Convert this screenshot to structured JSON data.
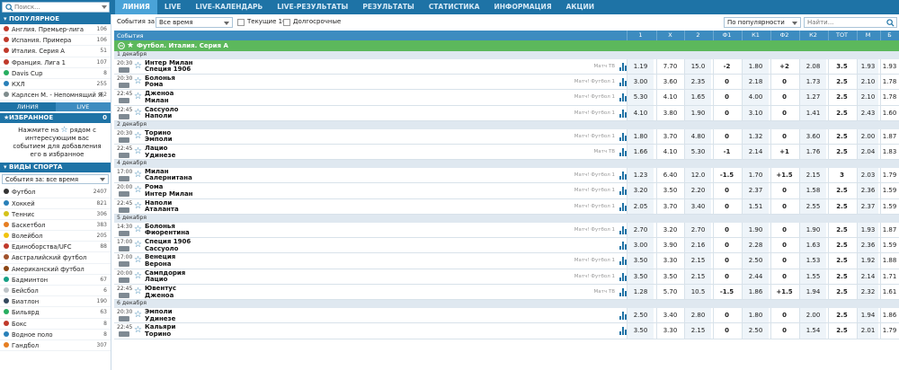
{
  "search": {
    "placeholder": "Поиск..."
  },
  "nav": [
    {
      "label": "ЛИНИЯ",
      "active": true
    },
    {
      "label": "LIVE",
      "active": false
    },
    {
      "label": "LIVE-КАЛЕНДАРЬ",
      "active": false
    },
    {
      "label": "LIVE-РЕЗУЛЬТАТЫ",
      "active": false
    },
    {
      "label": "РЕЗУЛЬТАТЫ",
      "active": false
    },
    {
      "label": "СТАТИСТИКА",
      "active": false
    },
    {
      "label": "ИНФОРМАЦИЯ",
      "active": false
    },
    {
      "label": "АКЦИИ",
      "active": false
    }
  ],
  "sidebar": {
    "popular_title": "ПОПУЛЯРНОЕ",
    "popular": [
      {
        "label": "Англия. Премьер-лига",
        "count": "106",
        "color": "#c0392b"
      },
      {
        "label": "Испания. Примера",
        "count": "106",
        "color": "#c0392b"
      },
      {
        "label": "Италия. Серия А",
        "count": "51",
        "color": "#c0392b"
      },
      {
        "label": "Франция. Лига 1",
        "count": "107",
        "color": "#c0392b"
      },
      {
        "label": "Davis Cup",
        "count": "8",
        "color": "#27ae60"
      },
      {
        "label": "КХЛ",
        "count": "255",
        "color": "#2980b9"
      },
      {
        "label": "Карлсен М. - Непомнящий Я.",
        "count": "42",
        "color": "#7f8c8d"
      }
    ],
    "tabs": [
      "ЛИНИЯ",
      "LIVE"
    ],
    "favorites_title": "ИЗБРАННОЕ",
    "favorites_count": "0",
    "favorites_msg_1": "Нажмите на",
    "favorites_msg_2": "рядом с интересующим вас событием для добавления его в избранное",
    "sports_title": "ВИДЫ СПОРТА",
    "sports_select": "События за: все время",
    "sports": [
      {
        "label": "Футбол",
        "count": "2407",
        "color": "#333"
      },
      {
        "label": "Хоккей",
        "count": "821",
        "color": "#2980b9"
      },
      {
        "label": "Теннис",
        "count": "306",
        "color": "#d4c21a"
      },
      {
        "label": "Баскетбол",
        "count": "383",
        "color": "#e67e22"
      },
      {
        "label": "Волейбол",
        "count": "205",
        "color": "#f1c40f"
      },
      {
        "label": "Единоборства/UFC",
        "count": "88",
        "color": "#c0392b"
      },
      {
        "label": "Австралийский футбол",
        "count": "",
        "color": "#a0522d"
      },
      {
        "label": "Американский футбол",
        "count": "",
        "color": "#8b4513"
      },
      {
        "label": "Бадминтон",
        "count": "67",
        "color": "#16a085"
      },
      {
        "label": "Бейсбол",
        "count": "6",
        "color": "#bdc3c7"
      },
      {
        "label": "Биатлон",
        "count": "190",
        "color": "#34495e"
      },
      {
        "label": "Бильярд",
        "count": "63",
        "color": "#27ae60"
      },
      {
        "label": "Бокс",
        "count": "8",
        "color": "#c0392b"
      },
      {
        "label": "Водное поло",
        "count": "8",
        "color": "#2980b9"
      },
      {
        "label": "Гандбол",
        "count": "307",
        "color": "#e67e22"
      }
    ]
  },
  "filters": {
    "events_label": "События за:",
    "events_value": "Все время",
    "current_label": "Текущие 16",
    "long_label": "Долгосрочные",
    "sort_value": "По популярности",
    "find_placeholder": "Найти..."
  },
  "table": {
    "events_label": "События",
    "columns": [
      "1",
      "X",
      "2",
      "Ф1",
      "К1",
      "Ф2",
      "К2",
      "ТОТ",
      "М",
      "Б"
    ],
    "league": "Футбол. Италия. Серия А"
  },
  "matches": [
    {
      "date": "1 декабря",
      "time": "20:30",
      "day": "1.12",
      "t1": "Интер Милан",
      "t2": "Специя 1906",
      "info": "Матч ТВ",
      "odds": [
        "1.19",
        "7.70",
        "15.0",
        "-2",
        "1.80",
        "+2",
        "2.08",
        "3.5",
        "1.93",
        "1.93"
      ]
    },
    {
      "date": "",
      "time": "20:30",
      "day": "1.12",
      "t1": "Болонья",
      "t2": "Рома",
      "info": "Матч! Футбол 1",
      "odds": [
        "3.00",
        "3.60",
        "2.35",
        "0",
        "2.18",
        "0",
        "1.73",
        "2.5",
        "2.10",
        "1.78"
      ]
    },
    {
      "date": "",
      "time": "22:45",
      "day": "1.12",
      "t1": "Дженоа",
      "t2": "Милан",
      "info": "Матч! Футбол 1",
      "odds": [
        "5.30",
        "4.10",
        "1.65",
        "0",
        "4.00",
        "0",
        "1.27",
        "2.5",
        "2.10",
        "1.78"
      ]
    },
    {
      "date": "",
      "time": "22:45",
      "day": "1.12",
      "t1": "Сассуоло",
      "t2": "Наполи",
      "info": "Матч! Футбол 1",
      "odds": [
        "4.10",
        "3.80",
        "1.90",
        "0",
        "3.10",
        "0",
        "1.41",
        "2.5",
        "2.43",
        "1.60"
      ]
    },
    {
      "date": "2 декабря",
      "time": "20:30",
      "day": "2.12",
      "t1": "Торино",
      "t2": "Эмполи",
      "info": "Матч! Футбол 1",
      "odds": [
        "1.80",
        "3.70",
        "4.80",
        "0",
        "1.32",
        "0",
        "3.60",
        "2.5",
        "2.00",
        "1.87"
      ]
    },
    {
      "date": "",
      "time": "22:45",
      "day": "2.12",
      "t1": "Лацио",
      "t2": "Удинезе",
      "info": "Матч ТВ",
      "odds": [
        "1.66",
        "4.10",
        "5.30",
        "-1",
        "2.14",
        "+1",
        "1.76",
        "2.5",
        "2.04",
        "1.83"
      ]
    },
    {
      "date": "4 декабря",
      "time": "17:00",
      "day": "4.12",
      "t1": "Милан",
      "t2": "Салернитана",
      "info": "Матч! Футбол 1",
      "odds": [
        "1.23",
        "6.40",
        "12.0",
        "-1.5",
        "1.70",
        "+1.5",
        "2.15",
        "3",
        "2.03",
        "1.79"
      ]
    },
    {
      "date": "",
      "time": "20:00",
      "day": "4.12",
      "t1": "Рома",
      "t2": "Интер Милан",
      "info": "Матч! Футбол 1",
      "odds": [
        "3.20",
        "3.50",
        "2.20",
        "0",
        "2.37",
        "0",
        "1.58",
        "2.5",
        "2.36",
        "1.59"
      ]
    },
    {
      "date": "",
      "time": "22:45",
      "day": "4.12",
      "t1": "Наполи",
      "t2": "Аталанта",
      "info": "Матч! Футбол 1",
      "odds": [
        "2.05",
        "3.70",
        "3.40",
        "0",
        "1.51",
        "0",
        "2.55",
        "2.5",
        "2.37",
        "1.59"
      ]
    },
    {
      "date": "5 декабря",
      "time": "14:30",
      "day": "5.12",
      "t1": "Болонья",
      "t2": "Фиорентина",
      "info": "Матч! Футбол 1",
      "odds": [
        "2.70",
        "3.20",
        "2.70",
        "0",
        "1.90",
        "0",
        "1.90",
        "2.5",
        "1.93",
        "1.87"
      ]
    },
    {
      "date": "",
      "time": "17:00",
      "day": "5.12",
      "t1": "Специя 1906",
      "t2": "Сассуоло",
      "info": "",
      "odds": [
        "3.00",
        "3.90",
        "2.16",
        "0",
        "2.28",
        "0",
        "1.63",
        "2.5",
        "2.36",
        "1.59"
      ]
    },
    {
      "date": "",
      "time": "17:00",
      "day": "5.12",
      "t1": "Венеция",
      "t2": "Верона",
      "info": "Матч! Футбол 1",
      "odds": [
        "3.50",
        "3.30",
        "2.15",
        "0",
        "2.50",
        "0",
        "1.53",
        "2.5",
        "1.92",
        "1.88"
      ]
    },
    {
      "date": "",
      "time": "20:00",
      "day": "5.12",
      "t1": "Сампдория",
      "t2": "Лацио",
      "info": "Матч! Футбол 1",
      "odds": [
        "3.50",
        "3.50",
        "2.15",
        "0",
        "2.44",
        "0",
        "1.55",
        "2.5",
        "2.14",
        "1.71"
      ]
    },
    {
      "date": "",
      "time": "22:45",
      "day": "5.12",
      "t1": "Ювентус",
      "t2": "Дженоа",
      "info": "Матч ТВ",
      "odds": [
        "1.28",
        "5.70",
        "10.5",
        "-1.5",
        "1.86",
        "+1.5",
        "1.94",
        "2.5",
        "2.32",
        "1.61"
      ]
    },
    {
      "date": "6 декабря",
      "time": "20:30",
      "day": "6.12",
      "t1": "Эмполи",
      "t2": "Удинезе",
      "info": "",
      "odds": [
        "2.50",
        "3.40",
        "2.80",
        "0",
        "1.80",
        "0",
        "2.00",
        "2.5",
        "1.94",
        "1.86"
      ]
    },
    {
      "date": "",
      "time": "22:45",
      "day": "6.12",
      "t1": "Кальяри",
      "t2": "Торино",
      "info": "",
      "odds": [
        "3.50",
        "3.30",
        "2.15",
        "0",
        "2.50",
        "0",
        "1.54",
        "2.5",
        "2.01",
        "1.79"
      ]
    }
  ],
  "colors": {
    "nav_bg": "#1e73a6",
    "nav_active": "#4aa3d8",
    "league_bg": "#5cb85c",
    "header_bg": "#3d8cc0",
    "accent": "#1e73a6"
  }
}
